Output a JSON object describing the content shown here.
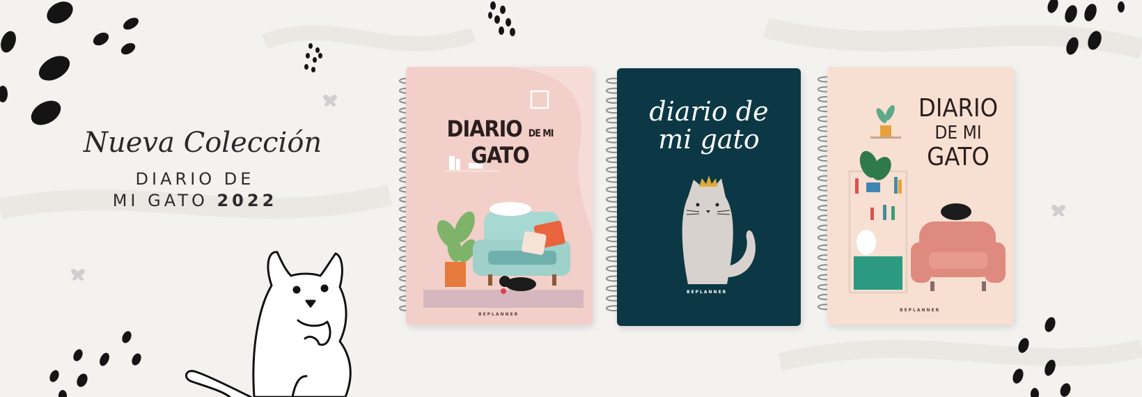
{
  "banner": {
    "tagline": "Nueva Colección",
    "title_line1": "DIARIO DE",
    "title_line2": "MI GATO",
    "year": "2022"
  },
  "notebooks": [
    {
      "title_line1": "DIARIO",
      "title_de_mi": "DE MI",
      "title_gato": "GATO",
      "brand": "BEPLANNER",
      "cover_color": "#f2cfc8"
    },
    {
      "title_line1": "diario de",
      "title_line2": "mi gato",
      "brand": "BEPLANNER",
      "cover_color": "#0c3845"
    },
    {
      "title_line1": "DIARIO",
      "title_line2": "DE MI",
      "title_line3": "GATO",
      "brand": "BEPLANNER",
      "cover_color": "#f7e0d2"
    }
  ],
  "colors": {
    "background": "#f4f2ef",
    "ink": "#1c1c1c",
    "pink_cover": "#f2cfc8",
    "teal_cover": "#0c3845",
    "peach_cover": "#f7e0d2"
  },
  "icons": [
    "paw-dot-cluster",
    "butterfly-icon",
    "cat-illustration",
    "spiral-binding"
  ]
}
